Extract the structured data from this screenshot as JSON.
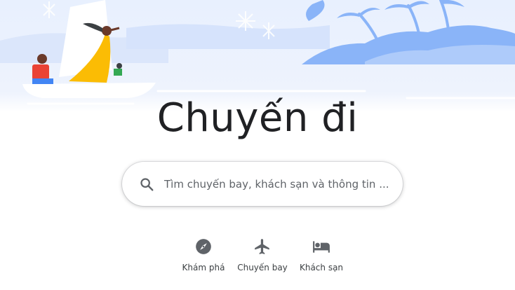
{
  "page": {
    "title": "Chuyến đi"
  },
  "search": {
    "placeholder": "Tìm chuyến bay, khách sạn và thông tin ..."
  },
  "nav": {
    "items": [
      {
        "label": "Khám phá",
        "icon": "compass-icon"
      },
      {
        "label": "Chuyến bay",
        "icon": "airplane-icon"
      },
      {
        "label": "Khách sạn",
        "icon": "bed-icon"
      }
    ]
  },
  "colors": {
    "sky": "#e8f0fe",
    "light_blue": "#aecbfa",
    "blue": "#8ab4f8",
    "text": "#202124",
    "icon": "#5f6368"
  }
}
